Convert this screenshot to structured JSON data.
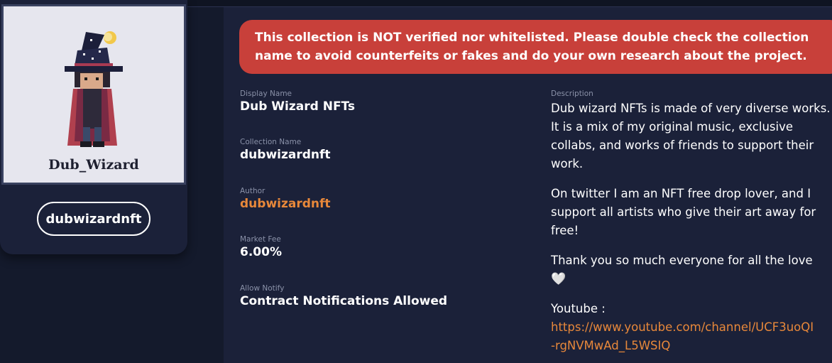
{
  "profile": {
    "avatar_caption": "Dub_Wizard",
    "username_button": "dubwizardnft"
  },
  "alert": {
    "text": "This collection is NOT verified nor whitelisted. Please double check the collection name to avoid counterfeits or fakes and do your own research about the project."
  },
  "fields": [
    {
      "label": "Display Name",
      "value": "Dub Wizard NFTs"
    },
    {
      "label": "Collection Name",
      "value": "dubwizardnft"
    },
    {
      "label": "Author",
      "value": "dubwizardnft"
    },
    {
      "label": "Market Fee",
      "value": "6.00%"
    },
    {
      "label": "Allow Notify",
      "value": "Contract Notifications Allowed"
    }
  ],
  "description": {
    "label": "Description",
    "p1": "Dub wizard NFTs is made of very diverse works. It is a mix of my original music, exclusive collabs, and works of friends to support their work.",
    "p2": "On twitter I am an NFT free drop lover, and I support all artists who give their art away for free!",
    "p3": "Thank you so much everyone for all the love",
    "heart": "🤍",
    "youtube_label": "Youtube :",
    "youtube_link_line1": "https://www.youtube.com/channel/UCF3uoQI",
    "youtube_link_line2": "-rgNVMwAd_L5WSIQ"
  },
  "colors": {
    "background": "#141a2c",
    "panel": "#1b2139",
    "alert": "#c8403a",
    "accent_orange": "#e8883a",
    "label_gray": "#8a91a8"
  }
}
